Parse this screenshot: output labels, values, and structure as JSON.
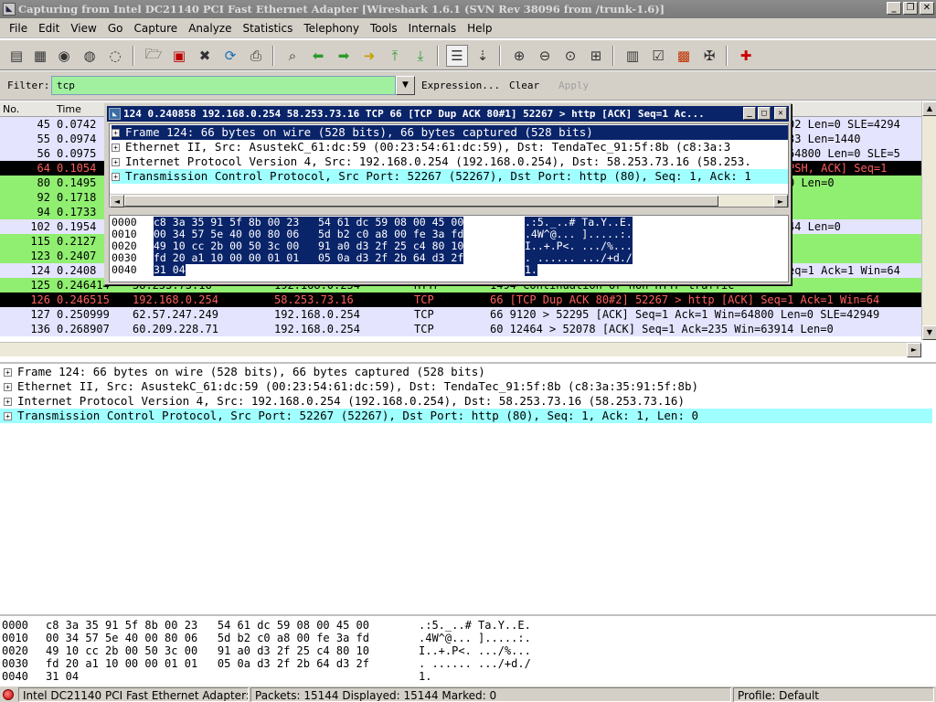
{
  "window": {
    "title": "Capturing from Intel DC21140 PCI Fast Ethernet Adapter   [Wireshark 1.6.1  (SVN Rev 38096 from /trunk-1.6)]",
    "app_icon": "wireshark-fin-icon",
    "controls": [
      "minimize",
      "restore",
      "close"
    ]
  },
  "menu": [
    "File",
    "Edit",
    "View",
    "Go",
    "Capture",
    "Analyze",
    "Statistics",
    "Telephony",
    "Tools",
    "Internals",
    "Help"
  ],
  "filter": {
    "label": "Filter:",
    "value": "tcp",
    "expression_label": "Expression...",
    "clear_label": "Clear",
    "apply_label": "Apply",
    "field_color": "#a0f0a0"
  },
  "columns": [
    "No.",
    "Time"
  ],
  "packets": [
    {
      "no": "45",
      "time": "0.0742",
      "src": "",
      "dst": "",
      "proto": "",
      "info": "02 Len=0 SLE=4294",
      "bg": "#e4e4ff",
      "fg": "#000000",
      "tail_only": true
    },
    {
      "no": "55",
      "time": "0.0974",
      "src": "",
      "dst": "",
      "proto": "",
      "info": "33 Len=1440",
      "bg": "#e4e4ff",
      "fg": "#000000",
      "tail_only": true
    },
    {
      "no": "56",
      "time": "0.0975",
      "src": "",
      "dst": "",
      "proto": "",
      "info": "64800 Len=0 SLE=5",
      "bg": "#e4e4ff",
      "fg": "#000000",
      "tail_only": true
    },
    {
      "no": "64",
      "time": "0.1054",
      "src": "",
      "dst": "",
      "proto": "",
      "info": "PSH, ACK] Seq=1",
      "bg": "#000000",
      "fg": "#ff5f5f",
      "tail_only": true
    },
    {
      "no": "80",
      "time": "0.1495",
      "src": "",
      "dst": "",
      "proto": "",
      "info": "0 Len=0",
      "bg": "#90ee70",
      "fg": "#000000",
      "tail_only": true
    },
    {
      "no": "92",
      "time": "0.1718",
      "src": "",
      "dst": "",
      "proto": "",
      "info": "",
      "bg": "#90ee70",
      "fg": "#000000",
      "tail_only": true
    },
    {
      "no": "94",
      "time": "0.1733",
      "src": "",
      "dst": "",
      "proto": "",
      "info": "",
      "bg": "#90ee70",
      "fg": "#000000",
      "tail_only": true
    },
    {
      "no": "102",
      "time": "0.1954",
      "src": "",
      "dst": "",
      "proto": "",
      "info": "44 Len=0",
      "bg": "#e4e4ff",
      "fg": "#000000",
      "tail_only": true
    },
    {
      "no": "115",
      "time": "0.2127",
      "src": "",
      "dst": "",
      "proto": "",
      "info": "",
      "bg": "#90ee70",
      "fg": "#000000",
      "tail_only": true
    },
    {
      "no": "123",
      "time": "0.2407",
      "src": "",
      "dst": "",
      "proto": "",
      "info": "",
      "bg": "#90ee70",
      "fg": "#000000",
      "tail_only": true
    },
    {
      "no": "124",
      "time": "0.2408",
      "src": "",
      "dst": "",
      "proto": "",
      "info": "eq=1 Ack=1 Win=64",
      "bg": "#e4e4ff",
      "fg": "#000000",
      "tail_only": true
    },
    {
      "no": "125",
      "time": "0.246414",
      "src": "58.253.73.16",
      "dst": "192.168.0.254",
      "proto": "HTTP",
      "info": "1494 Continuation or non-HTTP traffic",
      "bg": "#90ee70",
      "fg": "#000000",
      "tail_only": false
    },
    {
      "no": "126",
      "time": "0.246515",
      "src": "192.168.0.254",
      "dst": "58.253.73.16",
      "proto": "TCP",
      "info": "66 [TCP Dup ACK 80#2] 52267 > http [ACK] Seq=1 Ack=1 Win=64",
      "bg": "#000000",
      "fg": "#ff5f5f",
      "tail_only": false
    },
    {
      "no": "127",
      "time": "0.250999",
      "src": "62.57.247.249",
      "dst": "192.168.0.254",
      "proto": "TCP",
      "info": "66 9120 > 52295 [ACK] Seq=1 Ack=1 Win=64800 Len=0 SLE=42949",
      "bg": "#e4e4ff",
      "fg": "#000000",
      "tail_only": false
    },
    {
      "no": "136",
      "time": "0.268907",
      "src": "60.209.228.71",
      "dst": "192.168.0.254",
      "proto": "TCP",
      "info": "60 12464 > 52078 [ACK] Seq=1 Ack=235 Win=63914 Len=0",
      "bg": "#e4e4ff",
      "fg": "#000000",
      "tail_only": false
    }
  ],
  "details": [
    {
      "text": "Frame 124: 66 bytes on wire (528 bits), 66 bytes captured (528 bits)",
      "bg": "#ffffff"
    },
    {
      "text": "Ethernet II, Src: AsustekC_61:dc:59 (00:23:54:61:dc:59), Dst: TendaTec_91:5f:8b (c8:3a:35:91:5f:8b)",
      "bg": "#ffffff"
    },
    {
      "text": "Internet Protocol Version 4, Src: 192.168.0.254 (192.168.0.254), Dst: 58.253.73.16 (58.253.73.16)",
      "bg": "#ffffff"
    },
    {
      "text": "Transmission Control Protocol, Src Port: 52267 (52267), Dst Port: http (80), Seq: 1, Ack: 1, Len: 0",
      "bg": "#a0ffff"
    }
  ],
  "hex": [
    {
      "offset": "0000",
      "bytes": "c8 3a 35 91 5f 8b 00 23   54 61 dc 59 08 00 45 00",
      "ascii": ".:5._..# Ta.Y..E."
    },
    {
      "offset": "0010",
      "bytes": "00 34 57 5e 40 00 80 06   5d b2 c0 a8 00 fe 3a fd",
      "ascii": ".4W^@... ].....:."
    },
    {
      "offset": "0020",
      "bytes": "49 10 cc 2b 00 50 3c 00   91 a0 d3 2f 25 c4 80 10",
      "ascii": "I..+.P<. .../%..."
    },
    {
      "offset": "0030",
      "bytes": "fd 20 a1 10 00 00 01 01   05 0a d3 2f 2b 64 d3 2f",
      "ascii": ". ...... .../+d./"
    },
    {
      "offset": "0040",
      "bytes": "31 04",
      "ascii": "1."
    }
  ],
  "popup": {
    "title": "124 0.240858 192.168.0.254 58.253.73.16 TCP 66 [TCP Dup ACK 80#1] 52267 > http [ACK] Seq=1 Ac...",
    "tree": [
      {
        "text": "Frame 124: 66 bytes on wire (528 bits), 66 bytes captured (528 bits)",
        "bg": "#0a246a",
        "fg": "#ffffff"
      },
      {
        "text": "Ethernet II, Src: AsustekC_61:dc:59 (00:23:54:61:dc:59), Dst: TendaTec_91:5f:8b (c8:3a:3",
        "bg": "#ffffff",
        "fg": "#000000"
      },
      {
        "text": "Internet Protocol Version 4, Src: 192.168.0.254 (192.168.0.254), Dst: 58.253.73.16 (58.253.",
        "bg": "#ffffff",
        "fg": "#000000"
      },
      {
        "text": "Transmission Control Protocol, Src Port: 52267 (52267), Dst Port: http (80), Seq: 1, Ack: 1",
        "bg": "#a0ffff",
        "fg": "#000000"
      }
    ],
    "hex": [
      {
        "offset": "0000",
        "bytes": "c8 3a 35 91 5f 8b 00 23   54 61 dc 59 08 00 45 00",
        "ascii": ".:5._..# Ta.Y..E."
      },
      {
        "offset": "0010",
        "bytes": "00 34 57 5e 40 00 80 06   5d b2 c0 a8 00 fe 3a fd",
        "ascii": ".4W^@... ].....:."
      },
      {
        "offset": "0020",
        "bytes": "49 10 cc 2b 00 50 3c 00   91 a0 d3 2f 25 c4 80 10",
        "ascii": "I..+.P<. .../%..."
      },
      {
        "offset": "0030",
        "bytes": "fd 20 a1 10 00 00 01 01   05 0a d3 2f 2b 64 d3 2f",
        "ascii": ". ...... .../+d./"
      },
      {
        "offset": "0040",
        "bytes": "31 04",
        "ascii": "1."
      }
    ]
  },
  "status": {
    "interface": "Intel DC21140 PCI Fast Ethernet Adapter: <",
    "packets": "Packets: 15144 Displayed: 15144 Marked: 0",
    "profile": "Profile: Default"
  },
  "toolbar_icons": [
    "interface-list-icon",
    "capture-options-icon",
    "start-capture-icon",
    "stop-capture-icon",
    "restart-capture-icon",
    "open-file-icon",
    "save-file-icon",
    "close-file-icon",
    "reload-icon",
    "print-icon",
    "find-packet-icon",
    "go-back-icon",
    "go-forward-icon",
    "go-to-packet-icon",
    "go-first-icon",
    "go-last-icon",
    "colorize-icon",
    "auto-scroll-icon",
    "zoom-in-icon",
    "zoom-out-icon",
    "zoom-normal-icon",
    "resize-columns-icon",
    "capture-filters-icon",
    "display-filters-icon",
    "coloring-rules-icon",
    "preferences-icon",
    "help-icon"
  ]
}
